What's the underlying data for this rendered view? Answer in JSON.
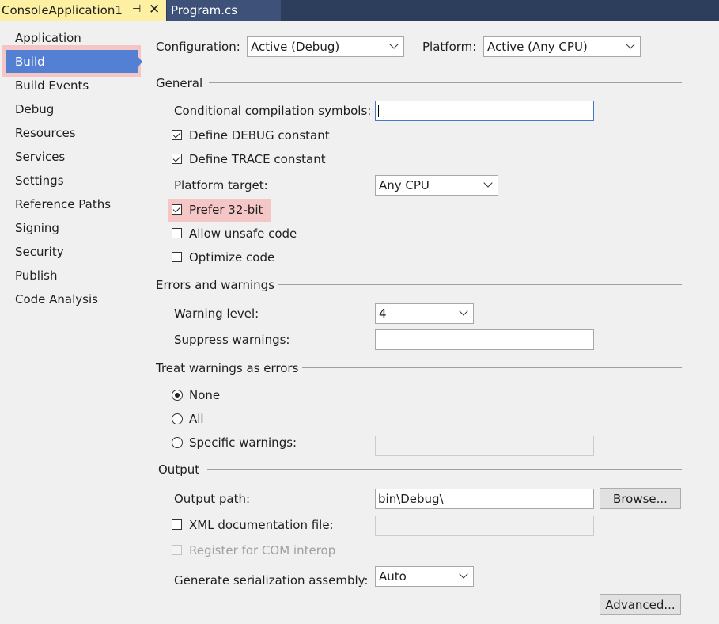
{
  "tabs": {
    "active": {
      "title": "ConsoleApplication1",
      "pin_icon": "pin-icon",
      "close_icon": "close-icon"
    },
    "inactive": {
      "title": "Program.cs"
    }
  },
  "sidebar": {
    "items": [
      {
        "label": "Application"
      },
      {
        "label": "Build"
      },
      {
        "label": "Build Events"
      },
      {
        "label": "Debug"
      },
      {
        "label": "Resources"
      },
      {
        "label": "Services"
      },
      {
        "label": "Settings"
      },
      {
        "label": "Reference Paths"
      },
      {
        "label": "Signing"
      },
      {
        "label": "Security"
      },
      {
        "label": "Publish"
      },
      {
        "label": "Code Analysis"
      }
    ],
    "selected": "Build"
  },
  "toolbar": {
    "configuration_label": "Configuration:",
    "configuration_value": "Active (Debug)",
    "platform_label": "Platform:",
    "platform_value": "Active (Any CPU)"
  },
  "general": {
    "title": "General",
    "conditional_symbols_label": "Conditional compilation symbols:",
    "conditional_symbols_value": "",
    "define_debug_label": "Define DEBUG constant",
    "define_debug_checked": true,
    "define_trace_label": "Define TRACE constant",
    "define_trace_checked": true,
    "platform_target_label": "Platform target:",
    "platform_target_value": "Any CPU",
    "prefer32_label": "Prefer 32-bit",
    "prefer32_checked": true,
    "allow_unsafe_label": "Allow unsafe code",
    "allow_unsafe_checked": false,
    "optimize_label": "Optimize code",
    "optimize_checked": false
  },
  "errors": {
    "title": "Errors and warnings",
    "warning_level_label": "Warning level:",
    "warning_level_value": "4",
    "suppress_label": "Suppress warnings:",
    "suppress_value": ""
  },
  "treat": {
    "title": "Treat warnings as errors",
    "none_label": "None",
    "all_label": "All",
    "specific_label": "Specific warnings:",
    "selected": "None",
    "specific_value": ""
  },
  "output": {
    "title": "Output",
    "path_label": "Output path:",
    "path_value": "bin\\Debug\\",
    "browse_label": "Browse...",
    "xml_doc_label": "XML documentation file:",
    "xml_doc_value": "",
    "com_interop_label": "Register for COM interop",
    "serialization_label": "Generate serialization assembly:",
    "serialization_value": "Auto",
    "advanced_label": "Advanced..."
  },
  "colors": {
    "active_tab": "#fef0a3",
    "tab_bar": "#2d3e5c",
    "selected_item": "#5480d4",
    "highlight": "#f4c6c6"
  }
}
